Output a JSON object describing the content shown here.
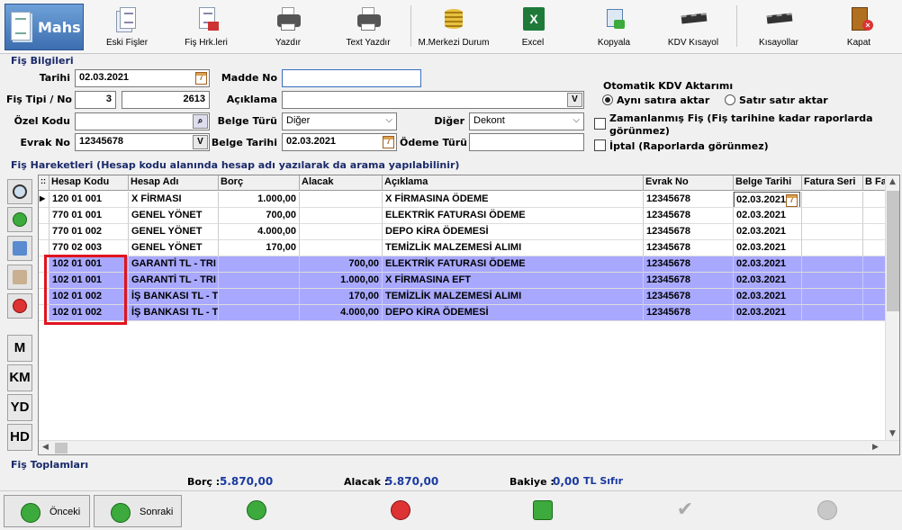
{
  "app": {
    "logo_text": "Mahs"
  },
  "toolbar": [
    {
      "id": "eski-fisler",
      "label": "Eski Fişler",
      "icon": "documents-icon"
    },
    {
      "id": "fis-hrk",
      "label": "Fiş Hrk.leri",
      "icon": "report-icon"
    },
    {
      "id": "yazdir",
      "label": "Yazdır",
      "icon": "printer-icon"
    },
    {
      "id": "text-yazdir",
      "label": "Text Yazdır",
      "icon": "text-printer-icon"
    },
    {
      "id": "mmerkezi",
      "label": "M.Merkezi Durum",
      "icon": "coins-icon"
    },
    {
      "id": "excel",
      "label": "Excel",
      "icon": "excel-icon"
    },
    {
      "id": "kopyala",
      "label": "Kopyala",
      "icon": "copy-icon"
    },
    {
      "id": "kdv",
      "label": "KDV Kısayol",
      "icon": "chip-icon"
    },
    {
      "id": "kisayollar",
      "label": "Kısayollar",
      "icon": "chip-icon"
    },
    {
      "id": "kapat",
      "label": "Kapat",
      "icon": "exit-door-icon"
    }
  ],
  "fis_bilgileri": {
    "title": "Fiş Bilgileri",
    "tarihi_label": "Tarihi",
    "tarihi": "02.03.2021",
    "fis_tipi_label": "Fiş Tipi / No",
    "fis_tipi": "3",
    "fis_no": "2613",
    "ozel_kodu_label": "Özel Kodu",
    "ozel_kodu": "",
    "evrak_no_label": "Evrak No",
    "evrak_no": "12345678",
    "madde_no_label": "Madde No",
    "madde_no": "",
    "aciklama_label": "Açıklama",
    "aciklama": "",
    "belge_turu_label": "Belge Türü",
    "belge_turu": "Diğer",
    "belge_tarihi_label": "Belge Tarihi",
    "belge_tarihi": "02.03.2021",
    "diger_label": "Diğer",
    "diger": "Dekont",
    "odeme_turu_label": "Ödeme Türü",
    "odeme_turu": "",
    "kdv_title": "Otomatik KDV Aktarımı",
    "radio_ayni": "Aynı satıra aktar",
    "radio_satir": "Satır satır aktar",
    "zamanlanmis_line1": "Zamanlanmış Fiş (Fiş tarihine kadar raporlarda",
    "zamanlanmis_line2": "görünmez)",
    "iptal": "İptal (Raporlarda görünmez)",
    "v_btn": "V",
    "cal_btn": "7"
  },
  "hareketler": {
    "title": "Fiş Hareketleri (Hesap kodu alanında hesap adı yazılarak da arama yapılabilinir)",
    "grip": "::",
    "columns": [
      "Hesap Kodu",
      "Hesap Adı",
      "Borç",
      "Alacak",
      "Açıklama",
      "Evrak No",
      "Belge Tarihi",
      "Fatura Seri",
      "B Fa"
    ],
    "rows": [
      {
        "kod": "120 01 001",
        "ad": "X FİRMASI",
        "borc": "1.000,00",
        "alacak": "",
        "aciklama": "X FİRMASINA ÖDEME",
        "evrak": "12345678",
        "tarih": "02.03.2021",
        "selected": false,
        "editing": true
      },
      {
        "kod": "770 01 001",
        "ad": "GENEL YÖNET",
        "borc": "700,00",
        "alacak": "",
        "aciklama": "ELEKTRİK FATURASI ÖDEME",
        "evrak": "12345678",
        "tarih": "02.03.2021",
        "selected": false
      },
      {
        "kod": "770 01 002",
        "ad": "GENEL YÖNET",
        "borc": "4.000,00",
        "alacak": "",
        "aciklama": "DEPO KİRA ÖDEMESİ",
        "evrak": "12345678",
        "tarih": "02.03.2021",
        "selected": false
      },
      {
        "kod": "770 02 003",
        "ad": "GENEL YÖNET",
        "borc": "170,00",
        "alacak": "",
        "aciklama": "TEMİZLİK MALZEMESİ ALIMI",
        "evrak": "12345678",
        "tarih": "02.03.2021",
        "selected": false
      },
      {
        "kod": "102 01 001",
        "ad": "GARANTİ TL - TRI",
        "borc": "",
        "alacak": "700,00",
        "aciklama": "ELEKTRİK FATURASI ÖDEME",
        "evrak": "12345678",
        "tarih": "02.03.2021",
        "selected": true
      },
      {
        "kod": "102 01 001",
        "ad": "GARANTİ TL - TRI",
        "borc": "",
        "alacak": "1.000,00",
        "aciklama": "X FİRMASINA EFT",
        "evrak": "12345678",
        "tarih": "02.03.2021",
        "selected": true
      },
      {
        "kod": "102 01 002",
        "ad": "İŞ BANKASI TL - T",
        "borc": "",
        "alacak": "170,00",
        "aciklama": "TEMİZLİK MALZEMESİ ALIMI",
        "evrak": "12345678",
        "tarih": "02.03.2021",
        "selected": true
      },
      {
        "kod": "102 01 002",
        "ad": "İŞ BANKASI TL - T",
        "borc": "",
        "alacak": "4.000,00",
        "aciklama": "DEPO KİRA ÖDEMESİ",
        "evrak": "12345678",
        "tarih": "02.03.2021",
        "selected": true
      }
    ]
  },
  "sidebar": {
    "m": "M",
    "km": "KM",
    "yd": "YD",
    "hd": "HD"
  },
  "totals": {
    "title": "Fiş Toplamları",
    "borc_label": "Borç :",
    "borc": "5.870,00",
    "alacak_label": "Alacak :",
    "alacak": "5.870,00",
    "bakiye_label": "Bakiye :",
    "bakiye": "0,00",
    "bakiye_unit": "TL Sıfır"
  },
  "bottom": {
    "onceki": "Önceki",
    "sonraki": "Sonraki"
  },
  "colors": {
    "selected_row": "#a8a8ff",
    "highlight_box": "#e0141e",
    "totals_value": "#1a3aa0"
  }
}
